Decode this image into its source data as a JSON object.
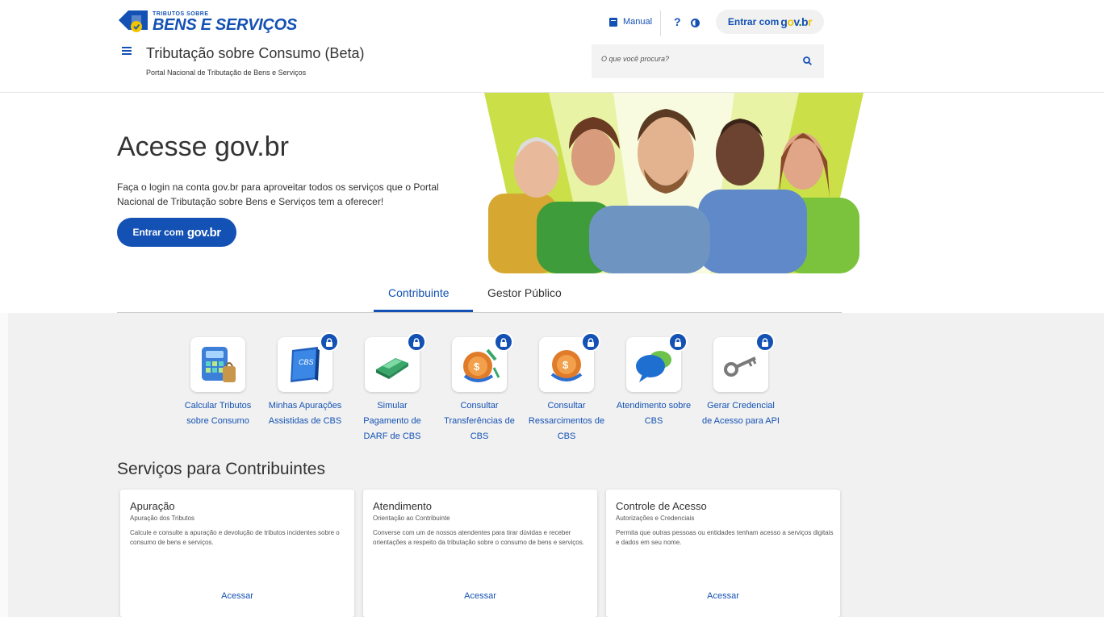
{
  "header": {
    "logo_small": "TRIBUTOS SOBRE",
    "logo_big": "BENS E SERVIÇOS",
    "site_title": "Tributação sobre Consumo (Beta)",
    "site_subtitle": "Portal Nacional de Tributação de Bens e Serviços",
    "manual_label": "Manual",
    "help_label": "?",
    "login_prefix": "Entrar com",
    "search_placeholder": "O que você procura?"
  },
  "hero": {
    "title": "Acesse gov.br",
    "description": "Faça o login na conta gov.br para aproveitar todos os serviços que o Portal Nacional de Tributação sobre Bens e Serviços tem a oferecer!",
    "button_prefix": "Entrar com",
    "button_brand": "gov.br"
  },
  "tabs": [
    {
      "label": "Contribuinte",
      "active": true
    },
    {
      "label": "Gestor Público",
      "active": false
    }
  ],
  "services": [
    {
      "line1": "Calcular Tributos",
      "line2": "sobre Consumo",
      "line3": "",
      "locked": false,
      "icon": "calculator-icon"
    },
    {
      "line1": "Minhas Apurações",
      "line2": "Assistidas de CBS",
      "line3": "",
      "locked": true,
      "icon": "cbs-book-icon"
    },
    {
      "line1": "Simular",
      "line2": "Pagamento de",
      "line3": "DARF de CBS",
      "locked": true,
      "icon": "money-icon"
    },
    {
      "line1": "Consultar",
      "line2": "Transferências de",
      "line3": "CBS",
      "locked": true,
      "icon": "transfer-icon"
    },
    {
      "line1": "Consultar",
      "line2": "Ressarcimentos de",
      "line3": "CBS",
      "locked": true,
      "icon": "refund-icon"
    },
    {
      "line1": "Atendimento sobre",
      "line2": "CBS",
      "line3": "",
      "locked": true,
      "icon": "chat-icon"
    },
    {
      "line1": "Gerar Credencial",
      "line2": "de Acesso para API",
      "line3": "",
      "locked": true,
      "icon": "key-icon"
    }
  ],
  "section_title": "Serviços para Contribuintes",
  "cards": [
    {
      "title": "Apuração",
      "subtitle": "Apuração dos Tributos",
      "description": "Calcule e consulte a apuração e devolução de tributos incidentes sobre o consumo de bens e serviços.",
      "link": "Acessar"
    },
    {
      "title": "Atendimento",
      "subtitle": "Orientação ao Contribuinte",
      "description": "Converse com um de nossos atendentes para tirar dúvidas e receber orientações a respeito da tributação sobre o consumo de bens e serviços.",
      "link": "Acessar"
    },
    {
      "title": "Controle de Acesso",
      "subtitle": "Autorizações e Credenciais",
      "description": "Permita que outras pessoas ou entidades tenham acesso a serviços digitais e dados em seu nome.",
      "link": "Acessar"
    }
  ],
  "colors": {
    "primary": "#1351b4",
    "background_gray": "#f1f1f1",
    "hero_green": "#c8dc3c"
  }
}
